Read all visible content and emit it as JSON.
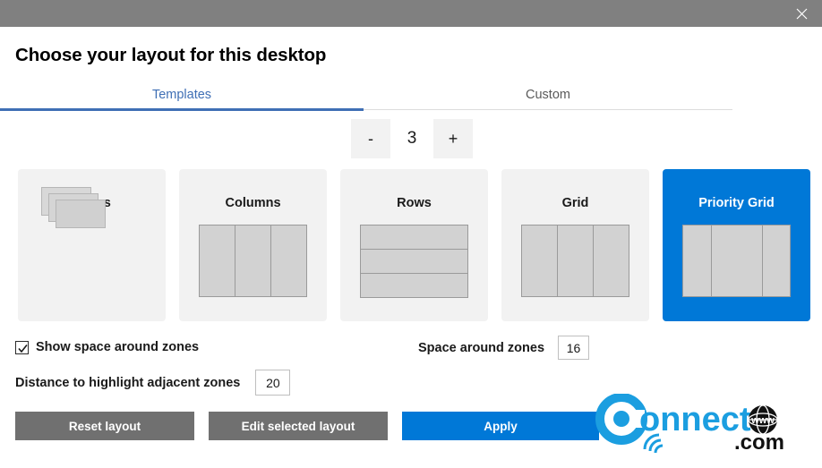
{
  "window": {
    "close_icon": "close-icon",
    "titlebar_color": "#808080"
  },
  "dialog": {
    "title": "Choose your layout for this desktop"
  },
  "tabs": [
    {
      "label": "Templates",
      "active": true
    },
    {
      "label": "Custom",
      "active": false
    }
  ],
  "stepper": {
    "decrement_label": "-",
    "increment_label": "+",
    "value": "3"
  },
  "layouts": [
    {
      "name": "Focus",
      "selected": false,
      "preview": "cascade"
    },
    {
      "name": "Columns",
      "selected": false,
      "preview": "columns-3"
    },
    {
      "name": "Rows",
      "selected": false,
      "preview": "rows-3"
    },
    {
      "name": "Grid",
      "selected": false,
      "preview": "columns-3"
    },
    {
      "name": "Priority Grid",
      "selected": true,
      "preview": "priority-3"
    }
  ],
  "options": {
    "show_space_label": "Show space around zones",
    "show_space_checked": true,
    "space_around_label": "Space around zones",
    "space_around_value": "16",
    "distance_label": "Distance to highlight adjacent zones",
    "distance_value": "20"
  },
  "footer": {
    "reset_label": "Reset layout",
    "edit_label": "Edit selected layout",
    "apply_label": "Apply"
  },
  "watermark": {
    "brand": "Connect",
    "suffix": ".com",
    "globe_text": "www",
    "color": "#1b9ee0"
  },
  "colors": {
    "accent": "#0078d7",
    "tab_active": "#3f6fb5",
    "button_gray": "#707070",
    "card_bg": "#f2f2f2",
    "zone_fill": "#d2d2d2"
  }
}
